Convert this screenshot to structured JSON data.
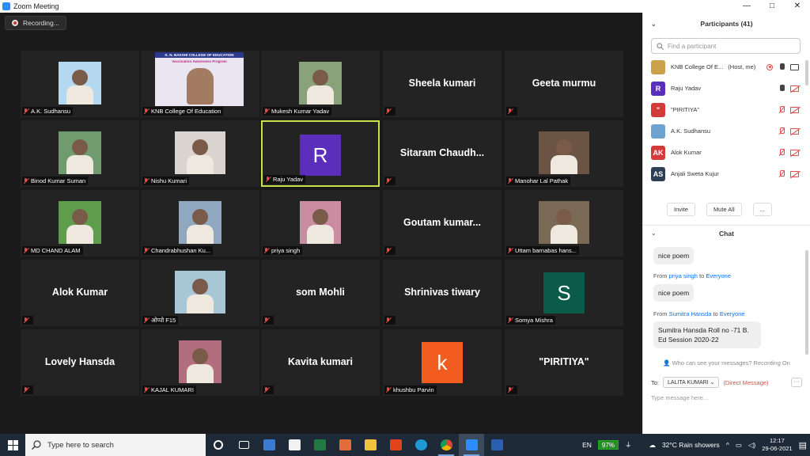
{
  "window": {
    "title": "Zoom Meeting",
    "min": "—",
    "max": "□",
    "close": "✕"
  },
  "recording": {
    "label": "Recording..."
  },
  "tiles": [
    {
      "label": "A.K. Sudhansu",
      "kind": "photo",
      "photo_color": "#b4d8f0"
    },
    {
      "label": "KNB College Of Education",
      "kind": "poster",
      "poster_line1": "K. N. BAKSHI COLLEGE OF EDUCATION",
      "poster_line2": "Vaccination Awareness Program"
    },
    {
      "label": "Mukesh Kumar Yadav",
      "kind": "photo",
      "photo_color": "#8aa27a"
    },
    {
      "label": "",
      "kind": "name",
      "name": "Sheela kumari"
    },
    {
      "label": "",
      "kind": "name",
      "name": "Geeta murmu"
    },
    {
      "label": "Binod Kumar Suman",
      "kind": "photo",
      "photo_color": "#6f9b6f"
    },
    {
      "label": "Nishu Kumari",
      "kind": "photo",
      "photo_color": "#d9d4cf"
    },
    {
      "label": "Raju Yadav",
      "kind": "avatar",
      "letter": "R",
      "avatar_color": "#5b2ebb",
      "active": true
    },
    {
      "label": "",
      "kind": "name",
      "name": "Sitaram  Chaudh..."
    },
    {
      "label": "Manohar Lal Pathak",
      "kind": "photo",
      "photo_color": "#6c5444"
    },
    {
      "label": "MD CHAND ALAM",
      "kind": "photo",
      "photo_color": "#5e9d4c"
    },
    {
      "label": "Chandrabhushan Ku...",
      "kind": "photo",
      "photo_color": "#8fa8c0"
    },
    {
      "label": "priya singh",
      "kind": "photo",
      "photo_color": "#c98ca0"
    },
    {
      "label": "",
      "kind": "name",
      "name": "Goutam  kumar..."
    },
    {
      "label": "Uttam barnabas hans...",
      "kind": "photo",
      "photo_color": "#7a6a55"
    },
    {
      "label": "",
      "kind": "name",
      "name": "Alok Kumar"
    },
    {
      "label": "ओप्पो F15",
      "kind": "photo",
      "photo_color": "#a7c7d6"
    },
    {
      "label": "",
      "kind": "name",
      "name": "som Mohli"
    },
    {
      "label": "",
      "kind": "name",
      "name": "Shrinivas tiwary"
    },
    {
      "label": "Somya Mishra",
      "kind": "avatar",
      "letter": "S",
      "avatar_color": "#0b5b4a"
    },
    {
      "label": "",
      "kind": "name",
      "name": "Lovely Hansda"
    },
    {
      "label": "KAJAL KUMARI",
      "kind": "photo",
      "photo_color": "#b26e7f"
    },
    {
      "label": "",
      "kind": "name",
      "name": "Kavita kumari"
    },
    {
      "label": "khushbu Parvin",
      "kind": "avatar",
      "letter": "k",
      "avatar_color": "#f25c1f"
    },
    {
      "label": "",
      "kind": "name",
      "name": "\"PIRITIYA\""
    }
  ],
  "participants": {
    "title": "Participants (41)",
    "search_placeholder": "Find a participant",
    "list": [
      {
        "name": "KNB College Of E...",
        "note": "(Host, me)",
        "initials": "",
        "color": "#c9a24b",
        "mic_on": true,
        "cam_on": true,
        "rec": true
      },
      {
        "name": "Raju Yadav",
        "note": "",
        "initials": "R",
        "color": "#5b2ebb",
        "mic_on": true,
        "cam_on": false,
        "rec": false
      },
      {
        "name": "\"PIRITIYA\"",
        "note": "",
        "initials": "\"",
        "color": "#d33a3a",
        "mic_on": false,
        "cam_on": false,
        "rec": false
      },
      {
        "name": "A.K. Sudhansu",
        "note": "",
        "initials": "",
        "color": "#6fa3cf",
        "mic_on": false,
        "cam_on": false,
        "rec": false
      },
      {
        "name": "Alok Kumar",
        "note": "",
        "initials": "AK",
        "color": "#d33a3a",
        "mic_on": false,
        "cam_on": false,
        "rec": false
      },
      {
        "name": "Anjali Sweta Kujur",
        "note": "",
        "initials": "AS",
        "color": "#2c3e58",
        "mic_on": false,
        "cam_on": false,
        "rec": false
      }
    ],
    "invite": "Invite",
    "mute_all": "Mute All",
    "more": "..."
  },
  "chat": {
    "title": "Chat",
    "messages": [
      {
        "from": "",
        "to": "",
        "text": "nice poem"
      },
      {
        "from": "priya singh",
        "to": "Everyone",
        "text": "nice poem"
      },
      {
        "from": "Sumitra Hansda",
        "to": "Everyone",
        "text": "Sumitra Hansda Roll no -71 B. Ed Session 2020-22"
      }
    ],
    "from_word": "From",
    "to_word": "to",
    "who_can_see": "Who can see your messages? Recording On",
    "to_label": "To:",
    "recipient": "LALITA KUMARI",
    "direct": "(Direct Message)",
    "more": "···",
    "placeholder": "Type message here..."
  },
  "taskbar": {
    "search_placeholder": "Type here to search",
    "lang": "EN",
    "battery": "97%",
    "weather": "32°C  Rain showers",
    "time": "12:17",
    "date": "29-06-2021"
  }
}
